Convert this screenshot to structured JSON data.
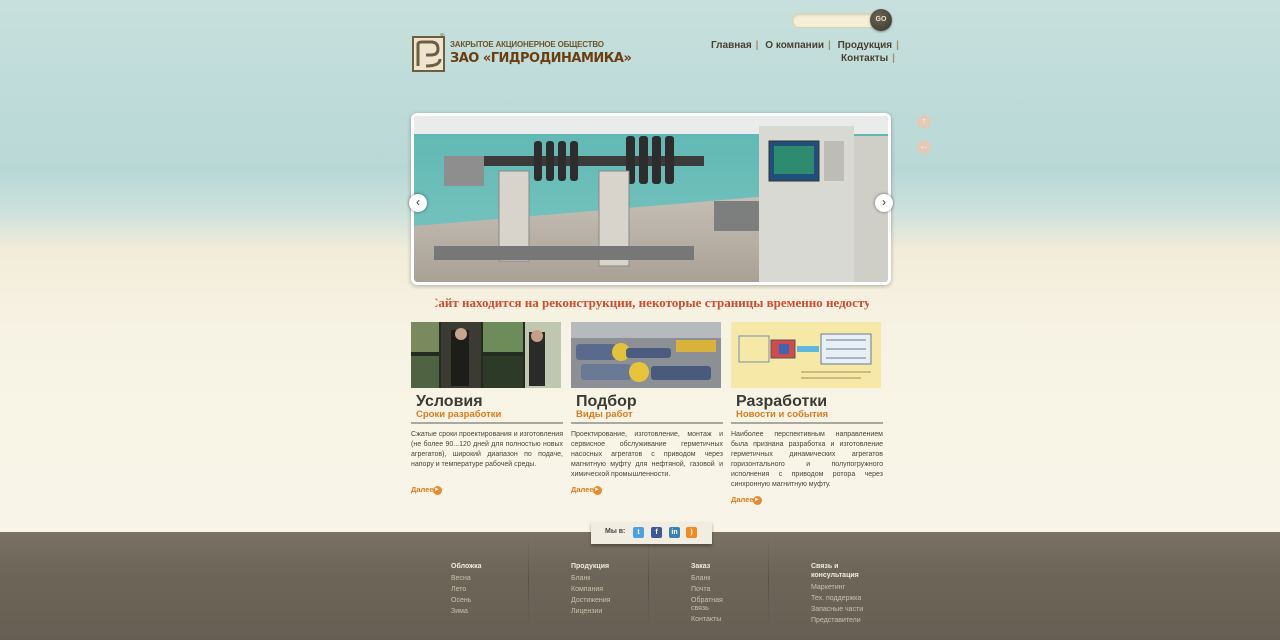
{
  "search": {
    "placeholder": "",
    "go_label": "GO"
  },
  "logo": {
    "small_text": "ЗАКРЫТОЕ АКЦИОНЕРНОЕ ОБЩЕСТВО",
    "big_text": "ЗАО «ГИДРОДИНАМИКА»",
    "mark": "ГД",
    "reg": "®"
  },
  "nav": {
    "items": [
      "Главная",
      "О компании",
      "Продукция",
      "Контакты"
    ],
    "separator": "|"
  },
  "slider": {
    "prev": "‹",
    "next": "›"
  },
  "side_buttons": {
    "up": "↑",
    "back": "←"
  },
  "marquee": "Сайт находится на реконструкции, некоторые страницы временно недоступны",
  "columns": [
    {
      "title": "Условия",
      "subtitle": "Сроки разработки",
      "text": "Сжатые сроки проектирования и изготовления (не более 90...120 дней для полностью новых агрегатов), широкий диапазон по подаче, напору и температуре рабочей среды.",
      "more": "Далее"
    },
    {
      "title": "Подбор",
      "subtitle": "Виды работ",
      "text": "Проектирование, изготовление, монтаж и сервисное обслуживание герметичных насосных агрегатов с приводом через магнитную муфту для нефтяной, газовой и химической промышленности.",
      "more": "Далее"
    },
    {
      "title": "Разработки",
      "subtitle": "Новости и события",
      "text": "Наиболее перспективным направлением была признана разработка и изготовление герметичных динамических агрегатов горизонтального и полупогружного исполнения с приводом ротора через синхронную магнитную муфту.",
      "more": "Далее"
    }
  ],
  "social": {
    "label": "Мы в:",
    "icons": [
      {
        "name": "twitter-icon",
        "glyph": "t",
        "color": "#4aa3df"
      },
      {
        "name": "facebook-icon",
        "glyph": "f",
        "color": "#3b5998"
      },
      {
        "name": "linkedin-icon",
        "glyph": "in",
        "color": "#3b7fb5"
      },
      {
        "name": "rss-icon",
        "glyph": ")",
        "color": "#f08a24"
      }
    ]
  },
  "footer": {
    "columns": [
      {
        "head": "Обложка",
        "items": [
          "Весна",
          "Лето",
          "Осень",
          "Зима"
        ]
      },
      {
        "head": "Продукция",
        "items": [
          "Бланк",
          "Компания",
          "Достижения",
          "Лицензии"
        ]
      },
      {
        "head": "Заказ",
        "items": [
          "Бланк",
          "Почта",
          "Обратная связь",
          "Контакты"
        ]
      },
      {
        "head": "Связь и консультация",
        "items": [
          "Маркетинг",
          "Тех. поддержка",
          "Запасные части",
          "Представители"
        ]
      }
    ]
  }
}
